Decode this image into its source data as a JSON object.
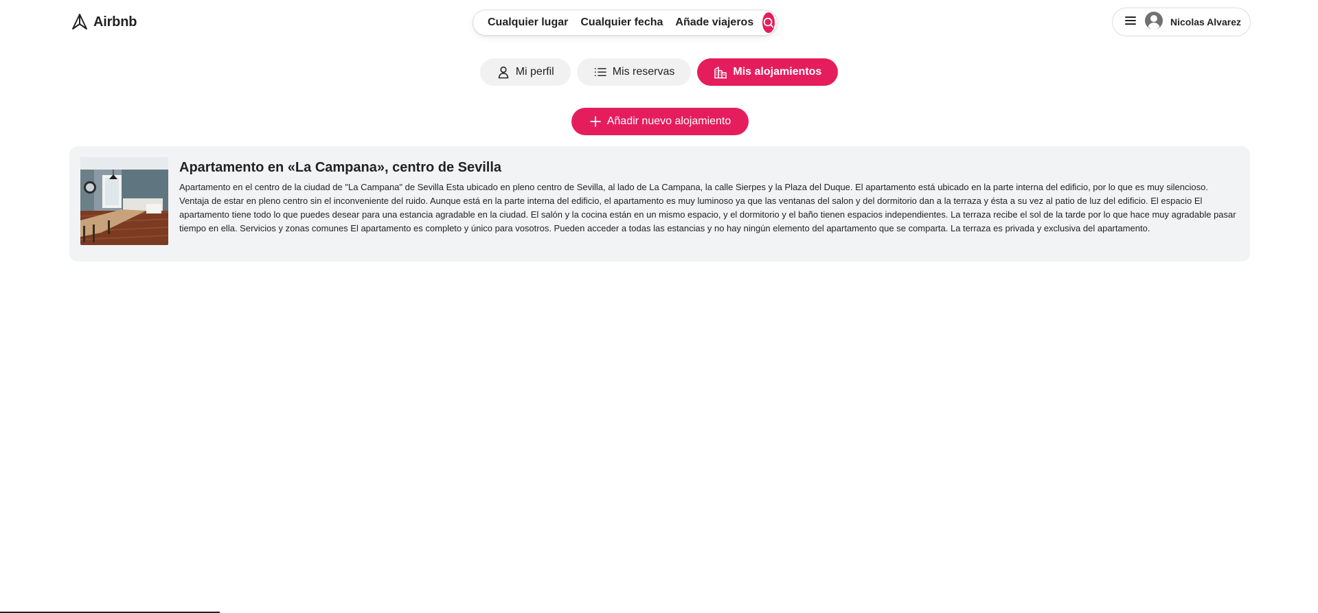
{
  "header": {
    "logo_text": "Airbnb",
    "search": {
      "place": "Cualquier lugar",
      "date": "Cualquier fecha",
      "guests": "Añade viajeros",
      "button_icon": "search-icon"
    },
    "user": {
      "menu_icon": "hamburger-menu-icon",
      "avatar_icon": "user-avatar-icon",
      "name": "Nicolas Alvarez"
    }
  },
  "tabs": [
    {
      "label": "Mi perfil",
      "icon": "person-icon",
      "active": false
    },
    {
      "label": "Mis reservas",
      "icon": "list-icon",
      "active": false
    },
    {
      "label": "Mis alojamientos",
      "icon": "building-icon",
      "active": true
    }
  ],
  "add_button": {
    "label": "Añadir nuevo alojamiento",
    "icon": "plus-icon"
  },
  "listings": [
    {
      "title": "Apartamento en «La Campana», centro de Sevilla",
      "description": "Apartamento en el centro de la ciudad de \"La Campana\" de Sevilla Esta ubicado en pleno centro de Sevilla, al lado de La Campana, la calle Sierpes y la Plaza del Duque. El apartamento está ubicado en la parte interna del edificio, por lo que es muy silencioso. Ventaja de estar en pleno centro sin el inconveniente del ruido. Aunque está en la parte interna del edificio, el apartamento es muy luminoso ya que las ventanas del salon y del dormitorio dan a la terraza y ésta a su vez al patio de luz del edificio. El espacio El apartamento tiene todo lo que puedes desear para una estancia agradable en la ciudad. El salón y la cocina están en un mismo espacio, y el dormitorio y el baño tienen espacios independientes. La terraza recibe el sol de la tarde por lo que hace muy agradable pasar tiempo en ella. Servicios y zonas comunes El apartamento es completo y único para vosotros. Pueden acceder a todas las estancias y no hay ningún elemento del apartamento que se comparta. La terraza es privada y exclusiva del apartamento."
    }
  ],
  "colors": {
    "accent": "#e51d5d",
    "tab_bg": "#f1f1f1",
    "card_bg": "#f2f3f5",
    "text": "#222222"
  }
}
